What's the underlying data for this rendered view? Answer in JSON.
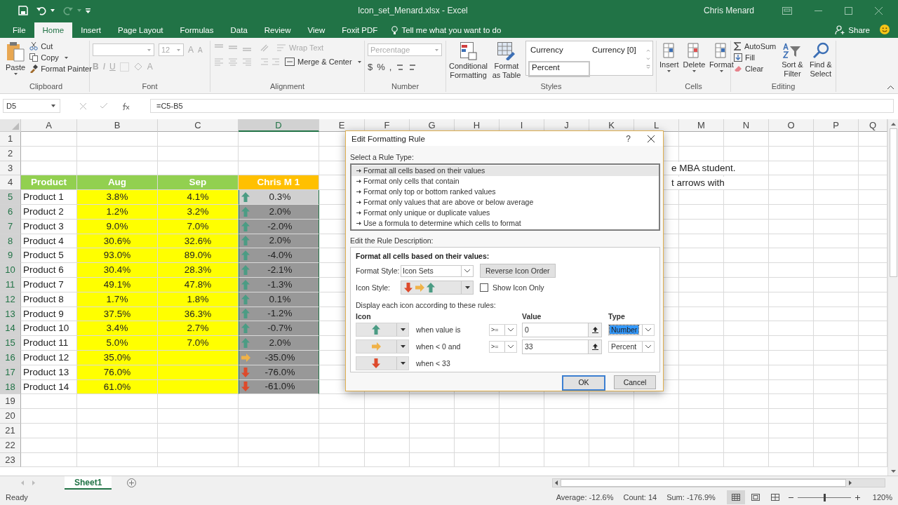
{
  "title_bar": {
    "title": "Icon_set_Menard.xlsx  -  Excel",
    "user": "Chris Menard"
  },
  "tabs": [
    {
      "label": "File",
      "selected": false
    },
    {
      "label": "Home",
      "selected": true
    },
    {
      "label": "Insert",
      "selected": false
    },
    {
      "label": "Page Layout",
      "selected": false
    },
    {
      "label": "Formulas",
      "selected": false
    },
    {
      "label": "Data",
      "selected": false
    },
    {
      "label": "Review",
      "selected": false
    },
    {
      "label": "View",
      "selected": false
    },
    {
      "label": "Foxit PDF",
      "selected": false
    }
  ],
  "tell_me": {
    "placeholder": "Tell me what you want to do"
  },
  "share": "Share",
  "ribbon": {
    "clipboard": {
      "label": "Clipboard",
      "paste": "Paste",
      "cut": "Cut",
      "copy": "Copy",
      "format_painter": "Format Painter"
    },
    "font": {
      "label": "Font",
      "disabled": true,
      "size": "12",
      "grow": "A",
      "shrink": "A",
      "bold": "B",
      "italic": "I",
      "underline": "U",
      "font_color": "A"
    },
    "alignment": {
      "label": "Alignment",
      "disabled": true,
      "wrap": "Wrap Text",
      "merge": "Merge & Center"
    },
    "number": {
      "label": "Number",
      "disabled": true,
      "format": "Percentage",
      "currency": "$",
      "percent": "%",
      "comma": ","
    },
    "styles": {
      "label": "Styles",
      "conditional": "Conditional Formatting",
      "format_table": "Format as Table",
      "cell_styles": [
        {
          "label": "Currency",
          "selected": false
        },
        {
          "label": "Currency [0]",
          "selected": false
        },
        {
          "label": "Percent",
          "selected": true
        }
      ]
    },
    "cells": {
      "label": "Cells",
      "buttons": [
        "Insert",
        "Delete",
        "Format"
      ]
    },
    "editing": {
      "label": "Editing",
      "autosum": "AutoSum",
      "fill": "Fill",
      "clear": "Clear",
      "sort": "Sort & Filter",
      "find": "Find & Select"
    }
  },
  "formula_bar": {
    "name_box": "D5",
    "formula": "=C5-B5"
  },
  "sheet": {
    "columns": [
      {
        "label": "A",
        "selected": false
      },
      {
        "label": "B",
        "selected": false
      },
      {
        "label": "C",
        "selected": false
      },
      {
        "label": "D",
        "selected": true
      },
      {
        "label": "E",
        "selected": false
      },
      {
        "label": "F",
        "selected": false
      },
      {
        "label": "G",
        "selected": false
      },
      {
        "label": "H",
        "selected": false
      },
      {
        "label": "I",
        "selected": false
      },
      {
        "label": "J",
        "selected": false
      },
      {
        "label": "K",
        "selected": false
      },
      {
        "label": "L",
        "selected": false
      },
      {
        "label": "M",
        "selected": false
      },
      {
        "label": "N",
        "selected": false
      },
      {
        "label": "O",
        "selected": false
      },
      {
        "label": "P",
        "selected": false
      },
      {
        "label": "Q",
        "selected": false
      }
    ],
    "rows": [
      {
        "number": "1",
        "selected": false,
        "kind": "blank"
      },
      {
        "number": "2",
        "selected": false,
        "kind": "blank"
      },
      {
        "number": "3",
        "selected": false,
        "kind": "blank"
      },
      {
        "number": "4",
        "selected": false,
        "kind": "header",
        "header": [
          {
            "text": "Product",
            "color": "#92d050"
          },
          {
            "text": "Aug",
            "color": "#92d050"
          },
          {
            "text": "Sep",
            "color": "#92d050"
          },
          {
            "text": "Chris M 1",
            "color": "#ffc000"
          }
        ]
      },
      {
        "number": "5",
        "selected": true,
        "kind": "data",
        "product": "Product 1",
        "aug": "3.8%",
        "sep": "4.1%",
        "change": {
          "kind": "up",
          "value": "0.3%",
          "selected": true,
          "active": true
        }
      },
      {
        "number": "6",
        "selected": true,
        "kind": "data",
        "product": "Product 2",
        "aug": "1.2%",
        "sep": "3.2%",
        "change": {
          "kind": "up",
          "value": "2.0%",
          "selected": true,
          "active": false
        }
      },
      {
        "number": "7",
        "selected": true,
        "kind": "data",
        "product": "Product 3",
        "aug": "9.0%",
        "sep": "7.0%",
        "change": {
          "kind": "up",
          "value": "-2.0%",
          "selected": true,
          "active": false
        }
      },
      {
        "number": "8",
        "selected": true,
        "kind": "data",
        "product": "Product 4",
        "aug": "30.6%",
        "sep": "32.6%",
        "change": {
          "kind": "up",
          "value": "2.0%",
          "selected": true,
          "active": false
        }
      },
      {
        "number": "9",
        "selected": true,
        "kind": "data",
        "product": "Product 5",
        "aug": "93.0%",
        "sep": "89.0%",
        "change": {
          "kind": "up",
          "value": "-4.0%",
          "selected": true,
          "active": false
        }
      },
      {
        "number": "10",
        "selected": true,
        "kind": "data",
        "product": "Product 6",
        "aug": "30.4%",
        "sep": "28.3%",
        "change": {
          "kind": "up",
          "value": "-2.1%",
          "selected": true,
          "active": false
        }
      },
      {
        "number": "11",
        "selected": true,
        "kind": "data",
        "product": "Product 7",
        "aug": "49.1%",
        "sep": "47.8%",
        "change": {
          "kind": "up",
          "value": "-1.3%",
          "selected": true,
          "active": false
        }
      },
      {
        "number": "12",
        "selected": true,
        "kind": "data",
        "product": "Product 8",
        "aug": "1.7%",
        "sep": "1.8%",
        "change": {
          "kind": "up",
          "value": "0.1%",
          "selected": true,
          "active": false
        }
      },
      {
        "number": "13",
        "selected": true,
        "kind": "data",
        "product": "Product 9",
        "aug": "37.5%",
        "sep": "36.3%",
        "change": {
          "kind": "up",
          "value": "-1.2%",
          "selected": true,
          "active": false
        }
      },
      {
        "number": "14",
        "selected": true,
        "kind": "data",
        "product": "Product 10",
        "aug": "3.4%",
        "sep": "2.7%",
        "change": {
          "kind": "up",
          "value": "-0.7%",
          "selected": true,
          "active": false
        }
      },
      {
        "number": "15",
        "selected": true,
        "kind": "data",
        "product": "Product 11",
        "aug": "5.0%",
        "sep": "7.0%",
        "change": {
          "kind": "up",
          "value": "2.0%",
          "selected": true,
          "active": false
        }
      },
      {
        "number": "16",
        "selected": true,
        "kind": "data",
        "product": "Product 12",
        "aug": "35.0%",
        "change": {
          "kind": "right",
          "value": "-35.0%",
          "selected": true,
          "active": false
        }
      },
      {
        "number": "17",
        "selected": true,
        "kind": "data",
        "product": "Product 13",
        "aug": "76.0%",
        "change": {
          "kind": "down",
          "value": "-76.0%",
          "selected": true,
          "active": false
        }
      },
      {
        "number": "18",
        "selected": true,
        "kind": "data",
        "product": "Product 14",
        "aug": "61.0%",
        "change": {
          "kind": "down",
          "value": "-61.0%",
          "selected": true,
          "active": false
        }
      },
      {
        "number": "19",
        "selected": false,
        "kind": "blank"
      },
      {
        "number": "20",
        "selected": false,
        "kind": "blank"
      },
      {
        "number": "21",
        "selected": false,
        "kind": "blank"
      },
      {
        "number": "22",
        "selected": false,
        "kind": "blank"
      },
      {
        "number": "23",
        "selected": false,
        "kind": "blank"
      }
    ],
    "overflow_text": [
      "e MBA student.",
      "t arrows with"
    ]
  },
  "dialog": {
    "title": "Edit Formatting Rule",
    "help": "?",
    "rule_type_label": "Select a Rule Type:",
    "rule_types": [
      {
        "label": "Format all cells based on their values",
        "selected": true
      },
      {
        "label": "Format only cells that contain",
        "selected": false
      },
      {
        "label": "Format only top or bottom ranked values",
        "selected": false
      },
      {
        "label": "Format only values that are above or below average",
        "selected": false
      },
      {
        "label": "Format only unique or duplicate values",
        "selected": false
      },
      {
        "label": "Use a formula to determine which cells to format",
        "selected": false
      }
    ],
    "description_label": "Edit the Rule Description:",
    "description_title": "Format all cells based on their values:",
    "format_style_label": "Format Style:",
    "format_style": "Icon Sets",
    "reverse_button": "Reverse Icon Order",
    "icon_style_label": "Icon Style:",
    "icon_style": [
      {
        "kind": "down"
      },
      {
        "kind": "right"
      },
      {
        "kind": "up"
      }
    ],
    "show_icon_only": {
      "label": "Show Icon Only",
      "checked": false
    },
    "rules_label": "Display each icon according to these rules:",
    "icon_header": "Icon",
    "value_header": "Value",
    "type_header": "Type",
    "rules": [
      {
        "kind": "up",
        "condition": "when value is",
        "operator": ">=",
        "value": "0",
        "type": "Number",
        "focused": true
      },
      {
        "kind": "right",
        "condition": "when < 0 and",
        "operator": ">=",
        "value": "33",
        "type": "Percent",
        "focused": false
      },
      {
        "kind": "down",
        "condition": "when < 33"
      }
    ],
    "ok": "OK",
    "cancel": "Cancel"
  },
  "sheet_tabs": [
    {
      "label": "Sheet1",
      "selected": true
    }
  ],
  "status_bar": {
    "mode": "Ready",
    "average": "Average: -12.6%",
    "count": "Count: 14",
    "sum": "Sum: -176.9%",
    "zoom_slider": {
      "level": 0.5
    },
    "zoom": "120%"
  }
}
